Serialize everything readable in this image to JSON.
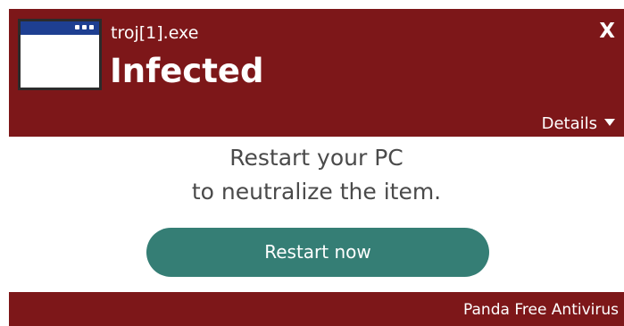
{
  "header": {
    "icon": "application-window-icon",
    "filename": "troj[1].exe",
    "status": "Infected",
    "close_label": "X",
    "details_label": "Details",
    "details_icon": "caret-down-icon"
  },
  "message": {
    "line1": "Restart your PC",
    "line2": "to neutralize the item."
  },
  "action": {
    "restart_label": "Restart now"
  },
  "footer": {
    "brand": "Panda Free Antivirus"
  },
  "colors": {
    "header_bg": "#7d1719",
    "button_bg": "#357e75",
    "text_dark": "#4a4a4a",
    "text_light": "#ffffff"
  }
}
